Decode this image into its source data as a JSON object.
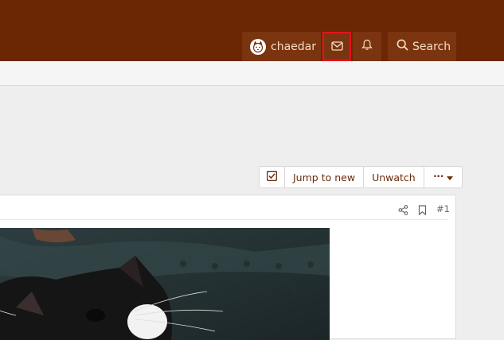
{
  "header": {
    "username": "chaedar",
    "search_label": "Search"
  },
  "thread_tools": {
    "jump_to_new": "Jump to new",
    "unwatch": "Unwatch",
    "more": "•••"
  },
  "post": {
    "number": "#1"
  },
  "colors": {
    "header_bg": "#6b2603",
    "header_button_bg": "#7a3510",
    "highlight_border": "#e8111f",
    "link_text": "#6b2a0a"
  },
  "icons": {
    "avatar": "cat-avatar-icon",
    "inbox": "envelope-icon",
    "alerts": "bell-icon",
    "search": "search-icon",
    "select": "checkbox-icon",
    "more": "caret-down-icon",
    "share": "share-icon",
    "bookmark": "bookmark-icon"
  }
}
